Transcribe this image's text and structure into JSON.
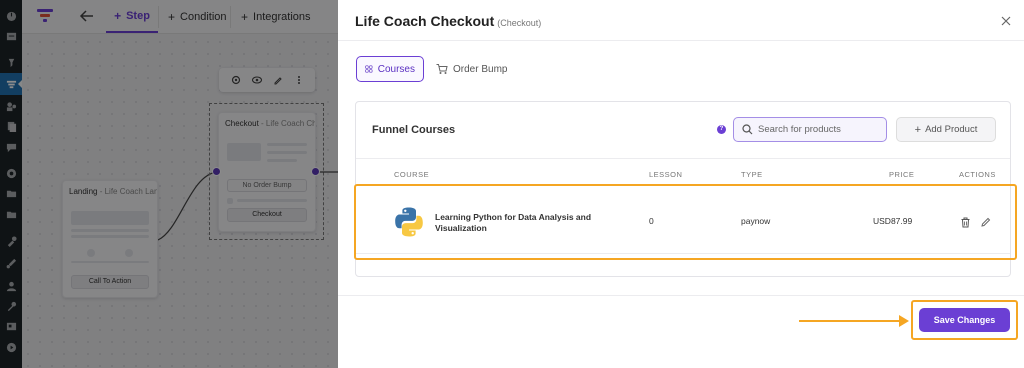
{
  "toolbar": {
    "tabs": [
      {
        "label": "Step"
      },
      {
        "label": "Condition"
      },
      {
        "label": "Integrations"
      }
    ]
  },
  "canvas": {
    "landing_node": {
      "title": "Landing",
      "subtitle": "- Life Coach Lan...",
      "button": "Call To Action"
    },
    "checkout_node": {
      "title": "Checkout",
      "subtitle": "- Life Coach Ch...",
      "bump_label": "No Order Bump",
      "button": "Checkout"
    }
  },
  "panel": {
    "title": "Life Coach Checkout",
    "title_sub": "(Checkout)",
    "subtabs": [
      {
        "label": "Courses"
      },
      {
        "label": "Order Bump"
      }
    ],
    "card": {
      "title": "Funnel Courses",
      "help": "?",
      "search_placeholder": "Search for products",
      "add_button": "Add Product",
      "columns": [
        "COURSE",
        "LESSON",
        "TYPE",
        "PRICE",
        "ACTIONS"
      ],
      "rows": [
        {
          "course": "Learning Python for Data Analysis and Visualization",
          "lesson": "0",
          "type": "paynow",
          "price": "USD87.99"
        }
      ]
    },
    "save_button": "Save Changes"
  },
  "colors": {
    "accent": "#6b3fd4",
    "highlight": "#f5a623",
    "wp_sidebar": "#1d2327"
  },
  "icons": {
    "wp_sidebar": [
      "dashboard-icon",
      "posts-icon",
      "pin-icon",
      "funnel-icon",
      "users-icon",
      "pages-icon",
      "comments-icon",
      "globe-icon",
      "folder-icon",
      "folder-icon",
      "tools-icon",
      "brush-icon",
      "person-icon",
      "wrench-icon",
      "media-icon",
      "play-icon"
    ]
  }
}
